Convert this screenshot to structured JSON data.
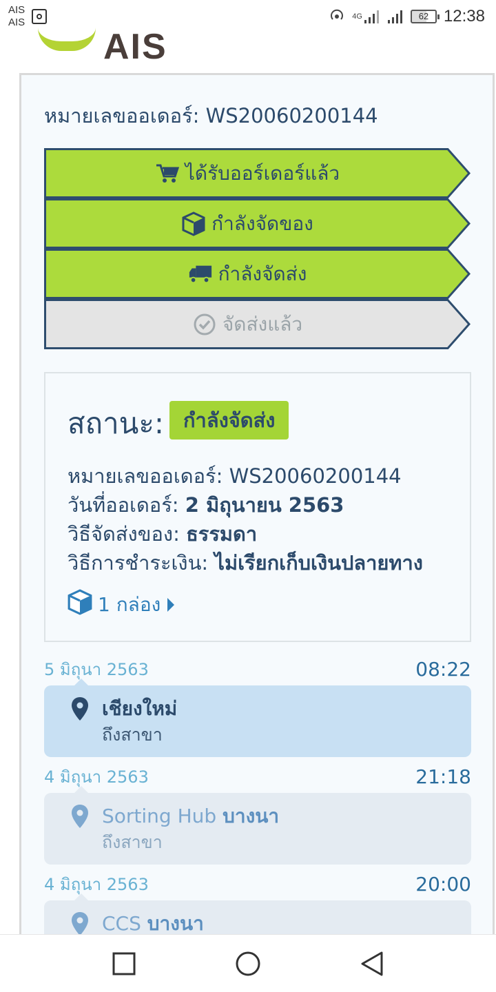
{
  "status_bar": {
    "carrier_line1": "AIS",
    "carrier_line2": "AIS",
    "network": "4G",
    "battery": "62",
    "time": "12:38"
  },
  "brand": {
    "logo_text": "AIS",
    "color": "#b4d334"
  },
  "order": {
    "label": "หมายเลขออเดอร์:",
    "number": "WS20060200144"
  },
  "steps": [
    {
      "label": "ได้รับออร์เดอร์แล้ว",
      "icon": "cart-icon",
      "done": true
    },
    {
      "label": "กำลังจัดของ",
      "icon": "box-icon",
      "done": true
    },
    {
      "label": "กำลังจัดส่ง",
      "icon": "truck-icon",
      "done": true
    },
    {
      "label": "จัดส่งแล้ว",
      "icon": "check-circle-icon",
      "done": false
    }
  ],
  "status": {
    "title": "สถานะ:",
    "badge": "กำลังจัดส่ง",
    "badge_color": "#a4d536",
    "lines": [
      {
        "label": "หมายเลขออเดอร์:",
        "value": "WS20060200144"
      },
      {
        "label": "วันที่ออเดอร์:",
        "value": "2 มิถุนายน 2563"
      },
      {
        "label": "วิธีจัดส่งของ:",
        "value": "ธรรมดา"
      },
      {
        "label": "วิธีการชำระเงิน:",
        "value": "ไม่เรียกเก็บเงินปลายทาง"
      }
    ],
    "box_link": "1 กล่อง"
  },
  "timeline": [
    {
      "date": "5 มิถุนา 2563",
      "time": "08:22",
      "place": "เชียงใหม่",
      "place_suffix": "",
      "sub": "ถึงสาขา",
      "active": true
    },
    {
      "date": "4 มิถุนา 2563",
      "time": "21:18",
      "place": "Sorting Hub ",
      "place_suffix": "บางนา",
      "sub": "ถึงสาขา",
      "active": false
    },
    {
      "date": "4 มิถุนา 2563",
      "time": "20:00",
      "place": "CCS ",
      "place_suffix": "บางนา",
      "sub": "",
      "active": false
    }
  ],
  "navbar": {
    "icons": [
      "recent-apps-icon",
      "home-icon",
      "back-icon"
    ]
  }
}
